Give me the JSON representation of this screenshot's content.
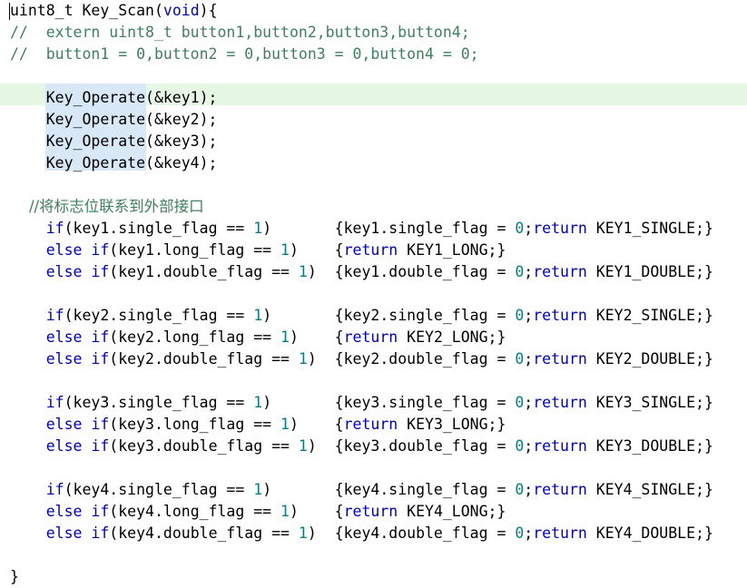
{
  "editor": {
    "colors": {
      "keyword": "#0000c0",
      "number": "#008080",
      "comment": "#3f7f5f",
      "plain": "#000000",
      "current_line": "#e6f7e6",
      "occurrence": "#d8e8f7"
    },
    "lines": [
      [
        {
          "t": "uint8_t Key_Scan(",
          "c": "pl"
        },
        {
          "t": "void",
          "c": "kw"
        },
        {
          "t": "){",
          "c": "pl"
        }
      ],
      [
        {
          "t": "//  extern uint8_t button1,button2,button3,button4;",
          "c": "cm"
        }
      ],
      [
        {
          "t": "//  button1 = 0,button2 = 0,button3 = 0,button4 = 0;",
          "c": "cm"
        }
      ],
      [],
      [
        {
          "t": "    Key_Operate(&key1);",
          "c": "pl"
        }
      ],
      [
        {
          "t": "    Key_Operate(&key2);",
          "c": "pl"
        }
      ],
      [
        {
          "t": "    Key_Operate(&key3);",
          "c": "pl"
        }
      ],
      [
        {
          "t": "    Key_Operate(&key4);",
          "c": "pl"
        }
      ],
      [],
      [
        {
          "t": "    //将标志位联系到外部接口",
          "c": "cm"
        }
      ],
      [
        {
          "t": "    ",
          "c": "pl"
        },
        {
          "t": "if",
          "c": "kw"
        },
        {
          "t": "(key1.single_flag == ",
          "c": "pl"
        },
        {
          "t": "1",
          "c": "num"
        },
        {
          "t": ")       {key1.single_flag = ",
          "c": "pl"
        },
        {
          "t": "0",
          "c": "num"
        },
        {
          "t": ";",
          "c": "pl"
        },
        {
          "t": "return",
          "c": "kw"
        },
        {
          "t": " KEY1_SINGLE;}",
          "c": "pl"
        }
      ],
      [
        {
          "t": "    ",
          "c": "pl"
        },
        {
          "t": "else if",
          "c": "kw"
        },
        {
          "t": "(key1.long_flag == ",
          "c": "pl"
        },
        {
          "t": "1",
          "c": "num"
        },
        {
          "t": ")    {",
          "c": "pl"
        },
        {
          "t": "return",
          "c": "kw"
        },
        {
          "t": " KEY1_LONG;}",
          "c": "pl"
        }
      ],
      [
        {
          "t": "    ",
          "c": "pl"
        },
        {
          "t": "else if",
          "c": "kw"
        },
        {
          "t": "(key1.double_flag == ",
          "c": "pl"
        },
        {
          "t": "1",
          "c": "num"
        },
        {
          "t": ")  {key1.double_flag = ",
          "c": "pl"
        },
        {
          "t": "0",
          "c": "num"
        },
        {
          "t": ";",
          "c": "pl"
        },
        {
          "t": "return",
          "c": "kw"
        },
        {
          "t": " KEY1_DOUBLE;}",
          "c": "pl"
        }
      ],
      [],
      [
        {
          "t": "    ",
          "c": "pl"
        },
        {
          "t": "if",
          "c": "kw"
        },
        {
          "t": "(key2.single_flag == ",
          "c": "pl"
        },
        {
          "t": "1",
          "c": "num"
        },
        {
          "t": ")       {key2.single_flag = ",
          "c": "pl"
        },
        {
          "t": "0",
          "c": "num"
        },
        {
          "t": ";",
          "c": "pl"
        },
        {
          "t": "return",
          "c": "kw"
        },
        {
          "t": " KEY2_SINGLE;}",
          "c": "pl"
        }
      ],
      [
        {
          "t": "    ",
          "c": "pl"
        },
        {
          "t": "else if",
          "c": "kw"
        },
        {
          "t": "(key2.long_flag == ",
          "c": "pl"
        },
        {
          "t": "1",
          "c": "num"
        },
        {
          "t": ")    {",
          "c": "pl"
        },
        {
          "t": "return",
          "c": "kw"
        },
        {
          "t": " KEY2_LONG;}",
          "c": "pl"
        }
      ],
      [
        {
          "t": "    ",
          "c": "pl"
        },
        {
          "t": "else if",
          "c": "kw"
        },
        {
          "t": "(key2.double_flag == ",
          "c": "pl"
        },
        {
          "t": "1",
          "c": "num"
        },
        {
          "t": ")  {key2.double_flag = ",
          "c": "pl"
        },
        {
          "t": "0",
          "c": "num"
        },
        {
          "t": ";",
          "c": "pl"
        },
        {
          "t": "return",
          "c": "kw"
        },
        {
          "t": " KEY2_DOUBLE;}",
          "c": "pl"
        }
      ],
      [],
      [
        {
          "t": "    ",
          "c": "pl"
        },
        {
          "t": "if",
          "c": "kw"
        },
        {
          "t": "(key3.single_flag == ",
          "c": "pl"
        },
        {
          "t": "1",
          "c": "num"
        },
        {
          "t": ")       {key3.single_flag = ",
          "c": "pl"
        },
        {
          "t": "0",
          "c": "num"
        },
        {
          "t": ";",
          "c": "pl"
        },
        {
          "t": "return",
          "c": "kw"
        },
        {
          "t": " KEY3_SINGLE;}",
          "c": "pl"
        }
      ],
      [
        {
          "t": "    ",
          "c": "pl"
        },
        {
          "t": "else if",
          "c": "kw"
        },
        {
          "t": "(key3.long_flag == ",
          "c": "pl"
        },
        {
          "t": "1",
          "c": "num"
        },
        {
          "t": ")    {",
          "c": "pl"
        },
        {
          "t": "return",
          "c": "kw"
        },
        {
          "t": " KEY3_LONG;}",
          "c": "pl"
        }
      ],
      [
        {
          "t": "    ",
          "c": "pl"
        },
        {
          "t": "else if",
          "c": "kw"
        },
        {
          "t": "(key3.double_flag == ",
          "c": "pl"
        },
        {
          "t": "1",
          "c": "num"
        },
        {
          "t": ")  {key3.double_flag = ",
          "c": "pl"
        },
        {
          "t": "0",
          "c": "num"
        },
        {
          "t": ";",
          "c": "pl"
        },
        {
          "t": "return",
          "c": "kw"
        },
        {
          "t": " KEY3_DOUBLE;}",
          "c": "pl"
        }
      ],
      [],
      [
        {
          "t": "    ",
          "c": "pl"
        },
        {
          "t": "if",
          "c": "kw"
        },
        {
          "t": "(key4.single_flag == ",
          "c": "pl"
        },
        {
          "t": "1",
          "c": "num"
        },
        {
          "t": ")       {key4.single_flag = ",
          "c": "pl"
        },
        {
          "t": "0",
          "c": "num"
        },
        {
          "t": ";",
          "c": "pl"
        },
        {
          "t": "return",
          "c": "kw"
        },
        {
          "t": " KEY4_SINGLE;}",
          "c": "pl"
        }
      ],
      [
        {
          "t": "    ",
          "c": "pl"
        },
        {
          "t": "else if",
          "c": "kw"
        },
        {
          "t": "(key4.long_flag == ",
          "c": "pl"
        },
        {
          "t": "1",
          "c": "num"
        },
        {
          "t": ")    {",
          "c": "pl"
        },
        {
          "t": "return",
          "c": "kw"
        },
        {
          "t": " KEY4_LONG;}",
          "c": "pl"
        }
      ],
      [
        {
          "t": "    ",
          "c": "pl"
        },
        {
          "t": "else if",
          "c": "kw"
        },
        {
          "t": "(key4.double_flag == ",
          "c": "pl"
        },
        {
          "t": "1",
          "c": "num"
        },
        {
          "t": ")  {key4.double_flag = ",
          "c": "pl"
        },
        {
          "t": "0",
          "c": "num"
        },
        {
          "t": ";",
          "c": "pl"
        },
        {
          "t": "return",
          "c": "kw"
        },
        {
          "t": " KEY4_DOUBLE;}",
          "c": "pl"
        }
      ],
      [],
      [
        {
          "t": "}",
          "c": "pl"
        }
      ]
    ]
  }
}
